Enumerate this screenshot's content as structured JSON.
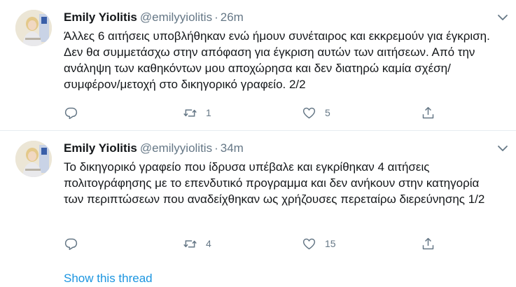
{
  "tweets": [
    {
      "author_name": "Emily Yiolitis",
      "handle": "@emilyyiolitis",
      "separator": "·",
      "time": "26m",
      "text": "Άλλες 6 αιτήσεις υποβλήθηκαν ενώ ήμουν συνέταιρος και εκκρεμούν για έγκριση. Δεν θα συμμετάσχω στην απόφαση για έγκριση αυτών των αιτήσεων. Από την ανάληψη των καθηκόντων μου αποχώρησα  και δεν διατηρώ καμία σχέση/συμφέρον/μετοχή στο δικηγορικό γραφείο. 2/2",
      "actions": {
        "reply_icon": "reply-icon",
        "retweet_icon": "retweet-icon",
        "retweet_count": "1",
        "like_icon": "heart-icon",
        "like_count": "5",
        "share_icon": "share-icon"
      }
    },
    {
      "author_name": "Emily Yiolitis",
      "handle": "@emilyyiolitis",
      "separator": "·",
      "time": "34m",
      "text": "Το δικηγορικό γραφείο που ίδρυσα υπέβαλε και εγκρίθηκαν 4 αιτήσεις πολιτογράφησης με το επενδυτικό προγραμμα και δεν ανήκουν στην κατηγορία των περιπτώσεων που αναδείχθηκαν ως χρήζουσες περεταίρω διερεύνησης 1/2",
      "actions": {
        "reply_icon": "reply-icon",
        "retweet_icon": "retweet-icon",
        "retweet_count": "4",
        "like_icon": "heart-icon",
        "like_count": "15",
        "share_icon": "share-icon"
      }
    }
  ],
  "show_thread_label": "Show this thread",
  "colors": {
    "text": "#14171a",
    "secondary": "#657786",
    "link": "#1b95e0",
    "divider": "#e6ecf0"
  }
}
